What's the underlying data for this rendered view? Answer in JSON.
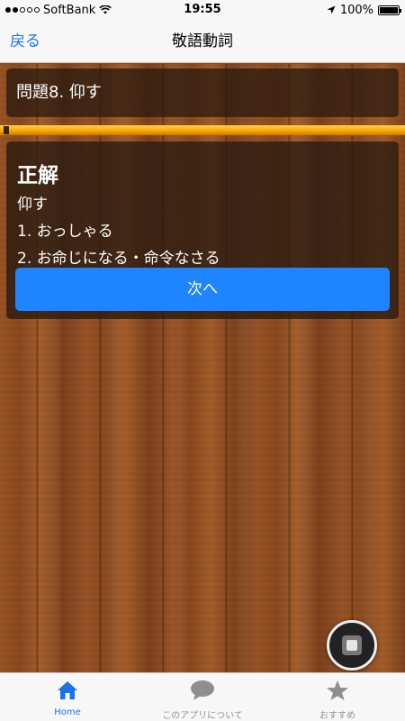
{
  "status_bar": {
    "carrier": "SoftBank",
    "time": "19:55",
    "battery": "100%",
    "battery_level": 1.0
  },
  "nav": {
    "back_label": "戻る",
    "title": "敬語動詞"
  },
  "question": {
    "text": "問題8. 仰す"
  },
  "progress": {
    "fraction": 1.0,
    "color": "#f6a300"
  },
  "answer": {
    "title": "正解",
    "word": "仰す",
    "lines": [
      "1. おっしゃる",
      "2. お命じになる・命令なさる"
    ],
    "next_label": "次へ"
  },
  "tabs": [
    {
      "label": "Home",
      "icon": "home-icon",
      "active": true
    },
    {
      "label": "このアプリについて",
      "icon": "speech-bubble-icon",
      "active": false
    },
    {
      "label": "おすすめ",
      "icon": "star-icon",
      "active": false
    }
  ],
  "colors": {
    "accent": "#1a73e8",
    "button": "#1e84ff",
    "inactive": "#929292"
  }
}
